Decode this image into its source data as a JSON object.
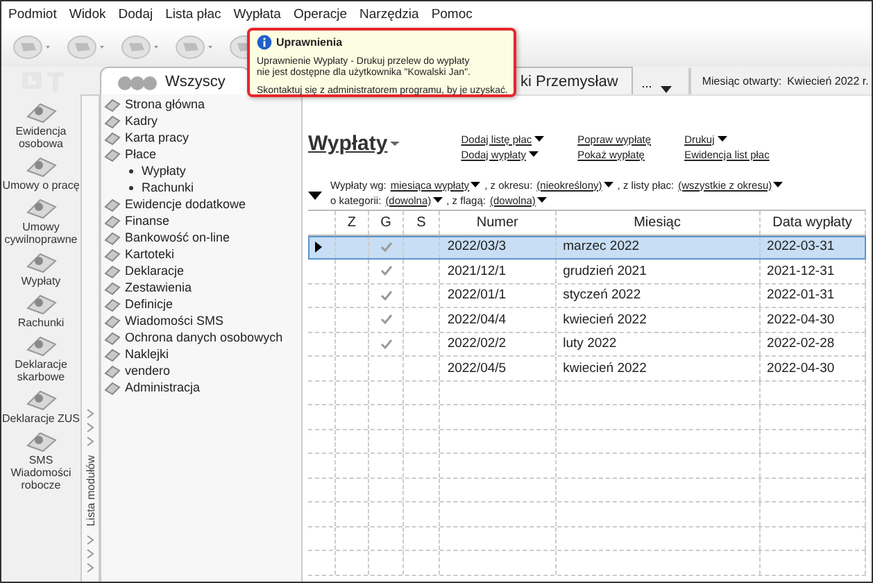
{
  "menu": [
    "Podmiot",
    "Widok",
    "Dodaj",
    "Lista płac",
    "Wypłata",
    "Operacje",
    "Narzędzia",
    "Pomoc"
  ],
  "tabs": [
    {
      "label": "Wszyscy",
      "selected": true
    },
    {
      "label": "ki Przemysław",
      "selected": false
    }
  ],
  "tab_more": "...",
  "month_open": {
    "label": "Miesiąc otwarty:",
    "value": "Kwiecień 2022 r."
  },
  "modules": [
    "Ewidencja osobowa",
    "Umowy o pracę",
    "Umowy cywilnoprawne",
    "Wypłaty",
    "Rachunki",
    "Deklaracje skarbowe",
    "Deklaracje ZUS",
    "SMS Wiadomości robocze"
  ],
  "module_list_label": "Lista modułów",
  "tree": [
    {
      "label": "Strona główna"
    },
    {
      "label": "Kadry"
    },
    {
      "label": "Karta pracy"
    },
    {
      "label": "Płace",
      "children": [
        {
          "label": "Wypłaty"
        },
        {
          "label": "Rachunki"
        }
      ]
    },
    {
      "label": "Ewidencje dodatkowe"
    },
    {
      "label": "Finanse"
    },
    {
      "label": "Bankowość on-line"
    },
    {
      "label": "Kartoteki"
    },
    {
      "label": "Deklaracje"
    },
    {
      "label": "Zestawienia"
    },
    {
      "label": "Definicje"
    },
    {
      "label": "Wiadomości SMS"
    },
    {
      "label": "Ochrona danych osobowych"
    },
    {
      "label": "Naklejki"
    },
    {
      "label": "vendero"
    },
    {
      "label": "Administracja"
    }
  ],
  "page_title": "Wypłaty",
  "actions": [
    {
      "label": "Dodaj listę płac",
      "dropdown": true
    },
    {
      "label": "Dodaj wypłaty",
      "dropdown": true
    },
    {
      "label": "Popraw wypłatę",
      "dropdown": false
    },
    {
      "label": "Pokaż wypłatę",
      "dropdown": false
    },
    {
      "label": "Drukuj",
      "dropdown": true
    },
    {
      "label": "Ewidencja list płac",
      "dropdown": false
    }
  ],
  "filters": [
    {
      "label": "Wypłaty wg:",
      "value": "miesiąca wypłaty"
    },
    {
      "label": ", z okresu:",
      "value": "(nieokreślony)"
    },
    {
      "label": ", z listy płac:",
      "value": "(wszystkie z okresu)"
    },
    {
      "label": "o kategorii:",
      "value": "(dowolna)"
    },
    {
      "label": ", z flagą:",
      "value": "(dowolna)"
    }
  ],
  "table": {
    "columns": [
      "Z",
      "G",
      "S",
      "Numer",
      "Miesiąc",
      "Data wypłaty"
    ],
    "rows": [
      {
        "selected": true,
        "g": true,
        "numer": "2022/03/3",
        "miesiac": "marzec 2022",
        "data": "2022-03-31"
      },
      {
        "selected": false,
        "g": true,
        "numer": "2021/12/1",
        "miesiac": "grudzień 2021",
        "data": "2021-12-31"
      },
      {
        "selected": false,
        "g": true,
        "numer": "2022/01/1",
        "miesiac": "styczeń 2022",
        "data": "2022-01-31"
      },
      {
        "selected": false,
        "g": true,
        "numer": "2022/04/4",
        "miesiac": "kwiecień 2022",
        "data": "2022-04-30"
      },
      {
        "selected": false,
        "g": true,
        "numer": "2022/02/2",
        "miesiac": "luty 2022",
        "data": "2022-02-28"
      },
      {
        "selected": false,
        "g": false,
        "numer": "2022/04/5",
        "miesiac": "kwiecień 2022",
        "data": "2022-04-30"
      }
    ]
  },
  "tooltip": {
    "title": "Uprawnienia",
    "lines": [
      "Uprawnienie Wypłaty - Drukuj przelew do wypłaty",
      "nie jest dostępne dla użytkownika \"Kowalski Jan\"."
    ],
    "note": "Skontaktuj się z administratorem programu, by je uzyskać."
  }
}
